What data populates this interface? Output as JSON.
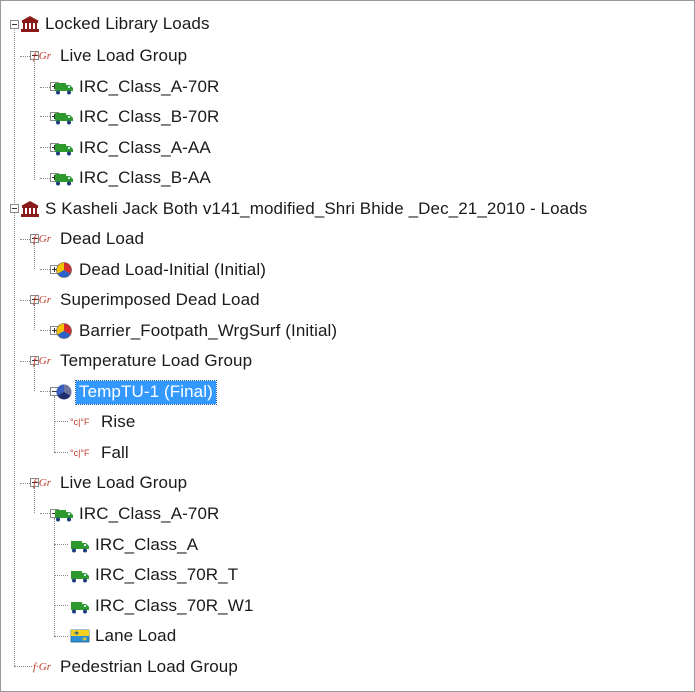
{
  "tree": {
    "locked": {
      "label": "Locked Library Loads",
      "icon": "library-building-icon",
      "group_live": {
        "label": "Live Load Group",
        "items": [
          "IRC_Class_A-70R",
          "IRC_Class_B-70R",
          "IRC_Class_A-AA",
          "IRC_Class_B-AA"
        ]
      }
    },
    "project": {
      "label": "S Kasheli Jack Both v141_modified_Shri Bhide _Dec_21_2010 - Loads",
      "icon": "library-building-icon",
      "dead": {
        "label": "Dead Load",
        "item": "Dead Load-Initial  (Initial)"
      },
      "superimposed": {
        "label": "Superimposed Dead Load",
        "item": "Barrier_Footpath_WrgSurf  (Initial)"
      },
      "temperature": {
        "label": "Temperature Load Group",
        "item": "TempTU-1  (Final)",
        "children": [
          "Rise",
          "Fall"
        ]
      },
      "live": {
        "label": "Live Load Group",
        "item": "IRC_Class_A-70R",
        "children": [
          "IRC_Class_A",
          "IRC_Class_70R_T",
          "IRC_Class_70R_W1",
          "Lane Load"
        ]
      },
      "pedestrian": {
        "label": "Pedestrian Load Group"
      }
    },
    "group_icon_text": "f·Gr",
    "temp_icon_text": "°c|°F"
  },
  "colors": {
    "selection": "#3399ff",
    "truck": "#2e9a2e",
    "library": "#8b1a1a",
    "group_icon": "#c0392b"
  }
}
